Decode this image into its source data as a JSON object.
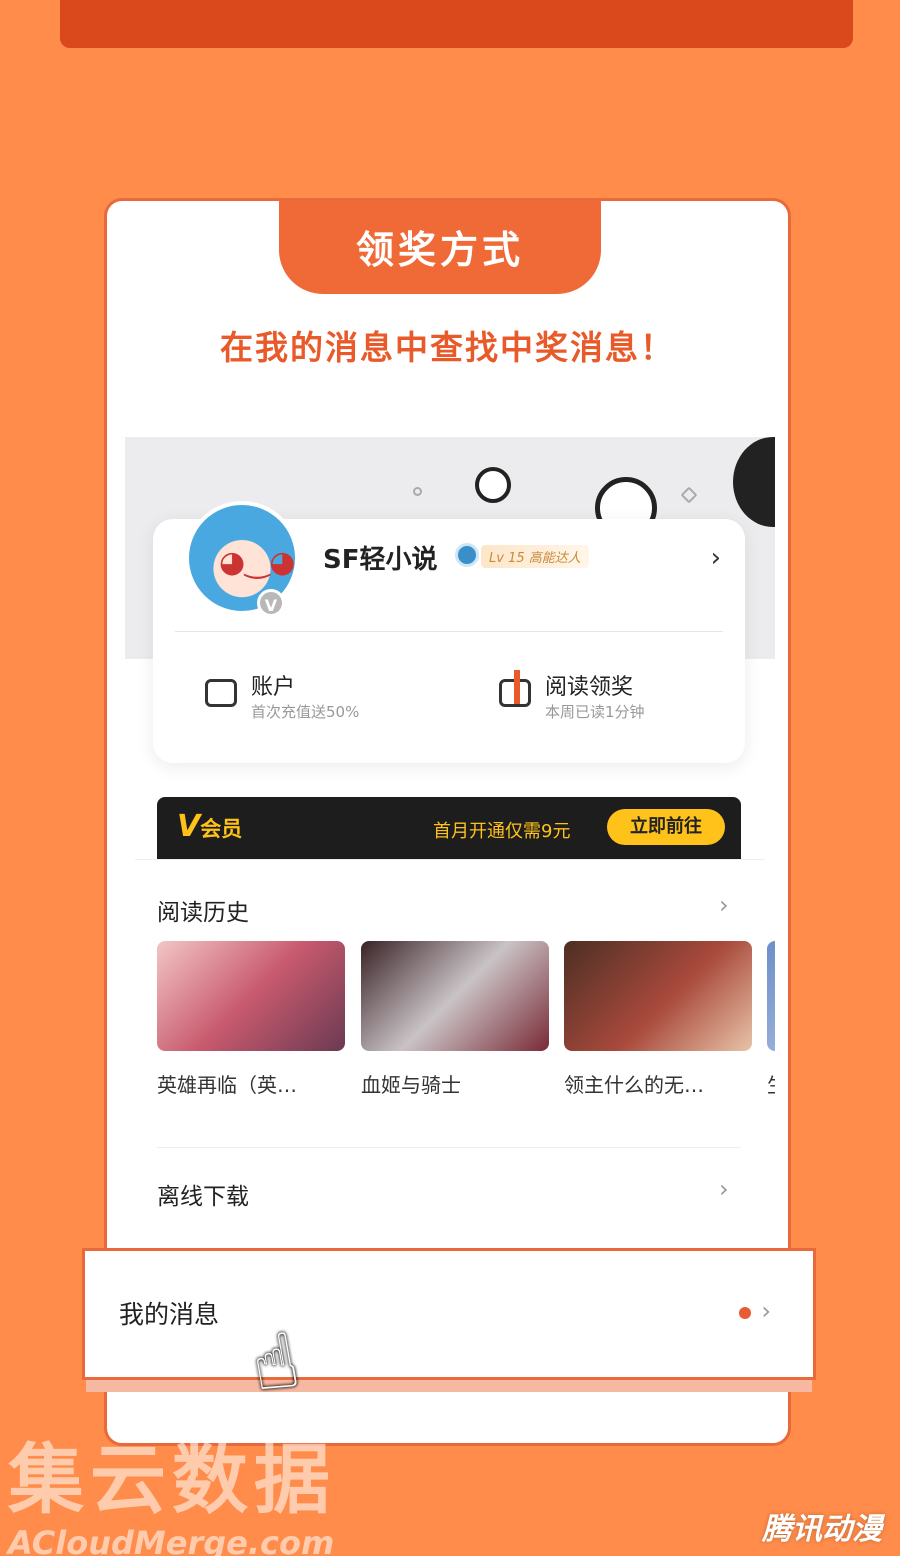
{
  "card": {
    "title": "领奖方式",
    "subtitle": "在我的消息中查找中奖消息！"
  },
  "profile": {
    "name": "SF轻小说",
    "level_badge": "Lv 15 高能达人",
    "avatar_badge": "V"
  },
  "stats": [
    {
      "label": "账户",
      "sub": "首次充值送50%"
    },
    {
      "label": "阅读领奖",
      "sub": "本周已读1分钟"
    }
  ],
  "vip": {
    "logo_v": "V",
    "logo_text": "会员",
    "desc": "首月开通仅需9元",
    "button": "立即前往"
  },
  "history": {
    "title": "阅读历史",
    "books": [
      {
        "title": "英雄再临（英…"
      },
      {
        "title": "血姬与骑士"
      },
      {
        "title": "领主什么的无…"
      },
      {
        "title": "生"
      }
    ]
  },
  "offline": {
    "title": "离线下载"
  },
  "messages": {
    "title": "我的消息"
  },
  "icons": {
    "chevron": "›",
    "hand": "☝"
  },
  "watermark": {
    "cn": "集云数据",
    "en": "ACloudMerge.com"
  },
  "corner_logo": "腾讯动漫",
  "colors": {
    "background": "#ff8c4a",
    "accent": "#f06a37",
    "vip_gold": "#ffc21a"
  }
}
